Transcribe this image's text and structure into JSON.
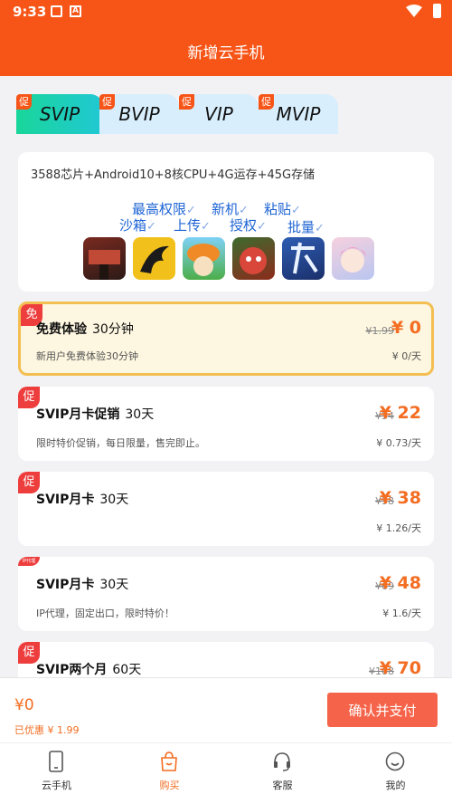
{
  "status_bar": {
    "time": "9:33"
  },
  "header": {
    "title": "新增云手机"
  },
  "tabs": [
    {
      "badge": "促",
      "label": "SVIP",
      "active": true
    },
    {
      "badge": "促",
      "label": "BVIP",
      "active": false
    },
    {
      "badge": "促",
      "label": "VIP",
      "active": false
    },
    {
      "badge": "促",
      "label": "MVIP",
      "active": false
    }
  ],
  "info": {
    "spec": "3588芯片+Android10+8核CPU+4G运存+45G存储",
    "perks": [
      "最高权限",
      "新机",
      "粘贴",
      "沙箱",
      "上传",
      "授权",
      "批量"
    ],
    "games": [
      "game-icon-days",
      "game-icon-dragon",
      "game-icon-mushroom",
      "game-icon-monster",
      "game-icon-calligraphy",
      "game-icon-anime-girl"
    ]
  },
  "plans": [
    {
      "badge": "免",
      "name": "免费体验",
      "duration": "30分钟",
      "desc": "新用户免费体验30分钟",
      "original": "¥1.99",
      "price": "¥ 0",
      "daily": "¥ 0/天",
      "selected": true
    },
    {
      "badge": "促",
      "name": "SVIP月卡促销",
      "duration": "30天",
      "desc": "限时特价促销，每日限量，售完即止。",
      "original": "¥54",
      "price": "¥ 22",
      "daily": "¥ 0.73/天",
      "selected": false
    },
    {
      "badge": "促",
      "name": "SVIP月卡",
      "duration": "30天",
      "desc": "",
      "original": "¥58",
      "price": "¥ 38",
      "daily": "¥ 1.26/天",
      "selected": false
    },
    {
      "badge": "IP代理",
      "name": "SVIP月卡",
      "duration": "30天",
      "desc": "IP代理，固定出口，限时特价！",
      "original": "¥69",
      "price": "¥ 48",
      "daily": "¥ 1.6/天",
      "selected": false
    },
    {
      "badge": "促",
      "name": "SVIP两个月",
      "duration": "60天",
      "desc": "",
      "original": "¥108",
      "price": "¥ 70",
      "daily": "",
      "selected": false
    }
  ],
  "paybar": {
    "total": "¥0",
    "saved": "已优惠 ¥ 1.99",
    "pay_label": "确认并支付"
  },
  "nav": [
    {
      "label": "云手机",
      "active": false
    },
    {
      "label": "购买",
      "active": true
    },
    {
      "label": "客服",
      "active": false
    },
    {
      "label": "我的",
      "active": false
    }
  ],
  "colors": {
    "brand": "#f75518",
    "price": "#f36d22",
    "badge": "#ee3d3d",
    "selected_border": "#f3bf52"
  }
}
